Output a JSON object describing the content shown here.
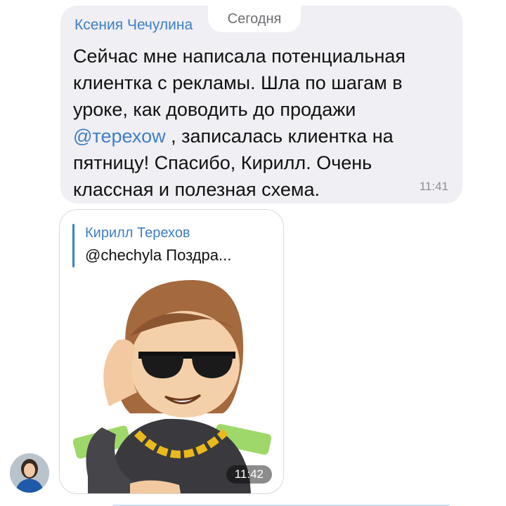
{
  "message1": {
    "sender": "Ксения Чечулина",
    "date_label": "Сегодня",
    "lines": [
      "Сейчас мне написала потенциальная",
      "клиентка с рекламы. Шла по шагам в",
      "уроке, как доводить до продажи",
      {
        "mention": "@терехоw",
        "rest": " , записалась клиентка на"
      },
      "пятницу!  Спасибо, Кирилл. Очень",
      "классная и полезная схема."
    ],
    "time": "11:41"
  },
  "message2": {
    "reply_name": "Кирилл Терехов",
    "reply_text": "@chechyla Поздра...",
    "time": "11:42"
  },
  "colors": {
    "accent": "#3f7fc4",
    "bubble": "#efeff4",
    "text": "#111111",
    "time": "#8e8e93"
  },
  "icons": {
    "avatar": "user-avatar",
    "sticker": "sunglasses-character-sticker"
  }
}
